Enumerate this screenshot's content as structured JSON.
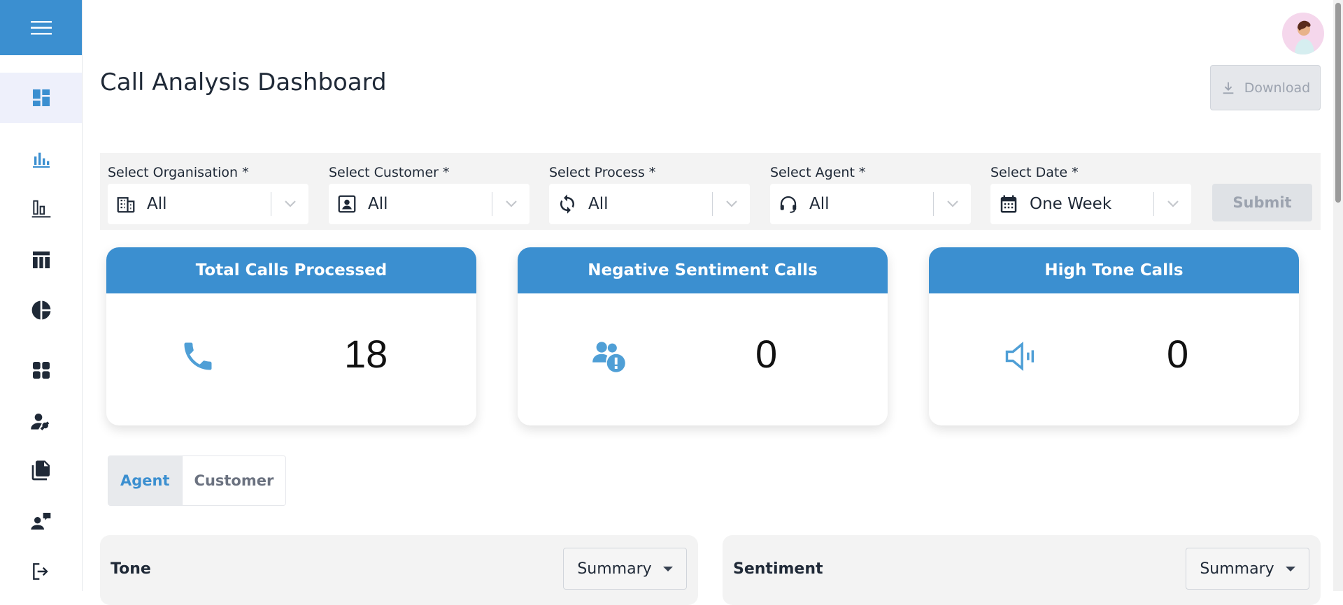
{
  "page": {
    "title": "Call Analysis Dashboard"
  },
  "toolbar": {
    "download_label": "Download",
    "submit_label": "Submit"
  },
  "filters": [
    {
      "label": "Select Organisation *",
      "value": "All",
      "icon": "building-icon"
    },
    {
      "label": "Select Customer *",
      "value": "All",
      "icon": "contact-card-icon"
    },
    {
      "label": "Select Process *",
      "value": "All",
      "icon": "sync-icon"
    },
    {
      "label": "Select Agent *",
      "value": "All",
      "icon": "headset-icon"
    },
    {
      "label": "Select Date *",
      "value": "One Week",
      "icon": "calendar-icon"
    }
  ],
  "stats": [
    {
      "title": "Total Calls Processed",
      "value": "18",
      "icon": "phone-icon"
    },
    {
      "title": "Negative Sentiment Calls",
      "value": "0",
      "icon": "users-alert-icon"
    },
    {
      "title": "High Tone Calls",
      "value": "0",
      "icon": "speaker-icon"
    }
  ],
  "tabs": {
    "agent": "Agent",
    "customer": "Customer",
    "active": "Agent"
  },
  "panels": [
    {
      "title": "Tone",
      "dropdown": "Summary"
    },
    {
      "title": "Sentiment",
      "dropdown": "Summary"
    }
  ],
  "sidebar": {
    "items": [
      "dashboard-icon",
      "bar-chart-icon",
      "column-chart-icon",
      "table-icon",
      "pie-chart-icon",
      "apps-icon",
      "user-settings-icon",
      "documents-icon",
      "chat-users-icon",
      "logout-icon"
    ],
    "active": "dashboard-icon"
  },
  "colors": {
    "accent": "#3b8fd0",
    "icon": "#1f2937",
    "muted": "#9ca3af"
  }
}
